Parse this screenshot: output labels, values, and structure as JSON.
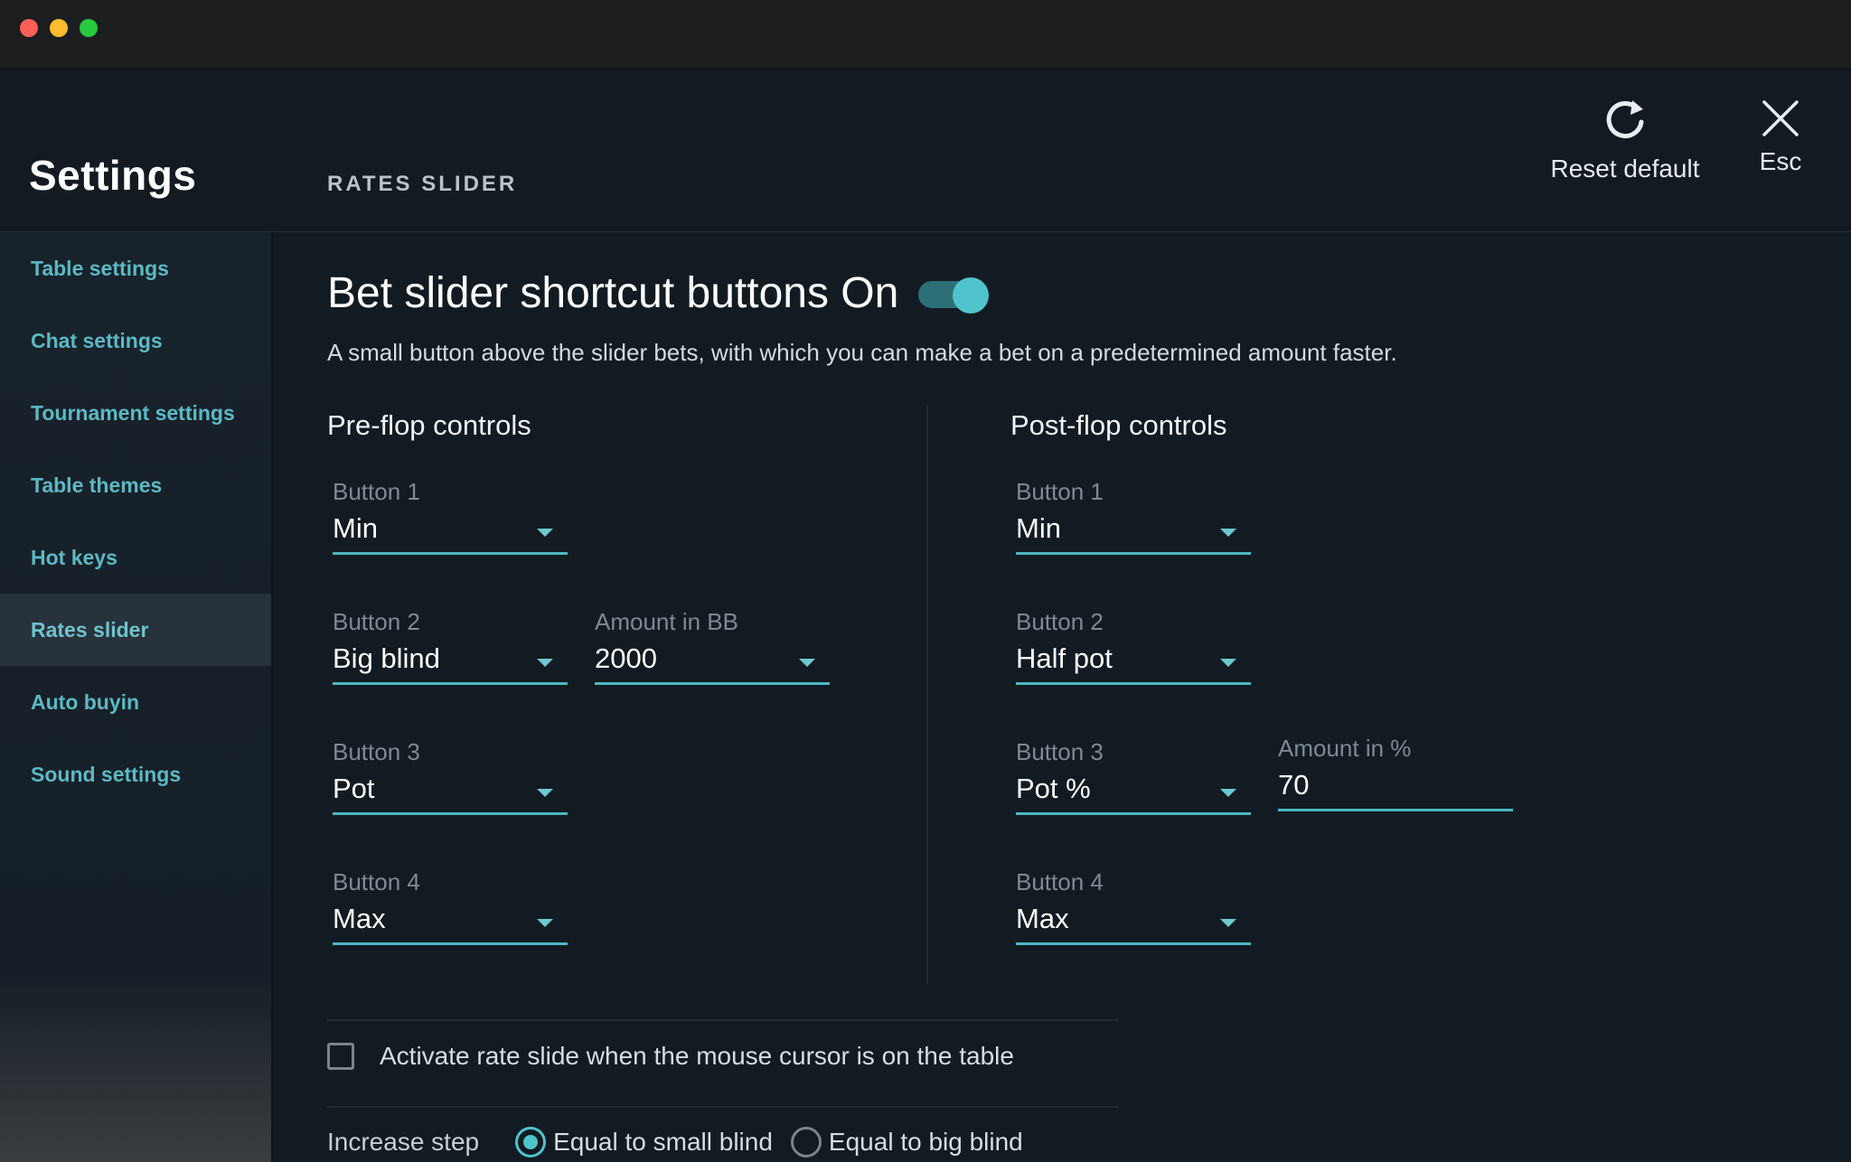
{
  "window": {
    "controls": [
      "close",
      "minimize",
      "zoom"
    ]
  },
  "header": {
    "app_title": "Settings",
    "section_title": "RATES SLIDER",
    "reset_label": "Reset default",
    "esc_label": "Esc",
    "reset_icon": "refresh-icon",
    "close_icon": "close-icon"
  },
  "sidebar": {
    "items": [
      {
        "label": "Table settings",
        "active": false
      },
      {
        "label": "Chat settings",
        "active": false
      },
      {
        "label": "Tournament settings",
        "active": false
      },
      {
        "label": "Table themes",
        "active": false
      },
      {
        "label": "Hot keys",
        "active": false
      },
      {
        "label": "Rates slider",
        "active": true
      },
      {
        "label": "Auto buyin",
        "active": false
      },
      {
        "label": "Sound settings",
        "active": false
      }
    ]
  },
  "main": {
    "toggle_title": "Bet slider shortcut buttons On",
    "toggle_on": true,
    "description": "A small button above the slider bets, with which you can make a bet on a predetermined amount faster.",
    "preflop": {
      "title": "Pre-flop controls",
      "buttons": [
        {
          "label": "Button 1",
          "value": "Min"
        },
        {
          "label": "Button 2",
          "value": "Big blind"
        },
        {
          "label": "Button 3",
          "value": "Pot"
        },
        {
          "label": "Button 4",
          "value": "Max"
        }
      ],
      "extra": {
        "label": "Amount in BB",
        "value": "2000"
      }
    },
    "postflop": {
      "title": "Post-flop controls",
      "buttons": [
        {
          "label": "Button 1",
          "value": "Min"
        },
        {
          "label": "Button 2",
          "value": "Half pot"
        },
        {
          "label": "Button 3",
          "value": "Pot %"
        },
        {
          "label": "Button 4",
          "value": "Max"
        }
      ],
      "extra": {
        "label": "Amount in %",
        "value": "70"
      }
    },
    "activate_checkbox": {
      "label": "Activate rate slide when the mouse cursor is on the table",
      "checked": false
    },
    "increase_step": {
      "label": "Increase step",
      "options": [
        {
          "label": "Equal to small blind",
          "selected": true
        },
        {
          "label": "Equal to big blind",
          "selected": false
        }
      ]
    }
  },
  "colors": {
    "accent": "#4fc4cd",
    "sidebar_text": "#5bb9c4",
    "background": "#131b22"
  }
}
